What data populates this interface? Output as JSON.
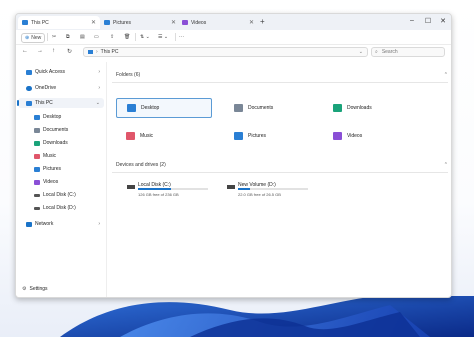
{
  "tabs": [
    {
      "label": "This PC",
      "active": true
    },
    {
      "label": "Pictures",
      "active": false
    },
    {
      "label": "Videos",
      "active": false
    }
  ],
  "window_controls": {
    "minimize": "–",
    "maximize": "☐",
    "close": "✕"
  },
  "toolbar": {
    "new_label": "New",
    "more_label": "···"
  },
  "address": {
    "location": "This PC",
    "search_placeholder": "Search"
  },
  "sidebar": {
    "items": [
      {
        "label": "Quick Access"
      },
      {
        "label": "OneDrive"
      },
      {
        "label": "This PC"
      },
      {
        "label": "Desktop"
      },
      {
        "label": "Documents"
      },
      {
        "label": "Downloads"
      },
      {
        "label": "Music"
      },
      {
        "label": "Pictures"
      },
      {
        "label": "Videos"
      },
      {
        "label": "Local Disk (C:)"
      },
      {
        "label": "Local Disk (D:)"
      },
      {
        "label": "Network"
      }
    ],
    "settings_label": "Settings"
  },
  "folders_section": {
    "title": "Folders (6)",
    "items": [
      {
        "label": "Desktop",
        "color": "#2a7fd4"
      },
      {
        "label": "Documents",
        "color": "#7a8797"
      },
      {
        "label": "Downloads",
        "color": "#1aa37a"
      },
      {
        "label": "Music",
        "color": "#e0566a"
      },
      {
        "label": "Pictures",
        "color": "#2a7fd4"
      },
      {
        "label": "Videos",
        "color": "#8a4fd6"
      }
    ]
  },
  "drives_section": {
    "title": "Devices and drives (2)",
    "items": [
      {
        "label": "Local Disk (C:)",
        "size": "126 GB free of 236 GB",
        "used_fraction": 0.47,
        "bar_color": "#1a73c8"
      },
      {
        "label": "New Volume (D:)",
        "size": "22.0 GB free of 26.5 GB",
        "used_fraction": 0.17,
        "bar_color": "#1a73c8"
      }
    ]
  },
  "accent_color": "#1a73c8"
}
